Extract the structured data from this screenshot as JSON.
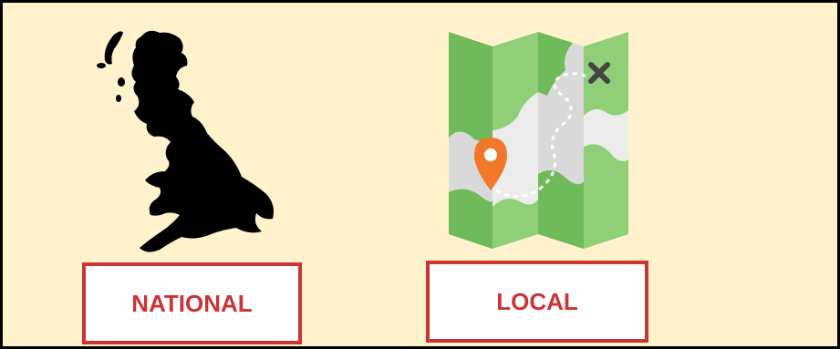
{
  "options": {
    "national": {
      "label": "NATIONAL",
      "icon": "uk-silhouette-icon"
    },
    "local": {
      "label": "LOCAL",
      "icon": "folded-map-icon"
    }
  },
  "colors": {
    "background": "#fff2cc",
    "frame": "#000000",
    "button_border": "#cc3333",
    "button_text": "#cc3333",
    "button_fill": "#ffffff",
    "map_green": "#7dc36b",
    "map_light": "#e6e6e6",
    "pin": "#f07828"
  }
}
